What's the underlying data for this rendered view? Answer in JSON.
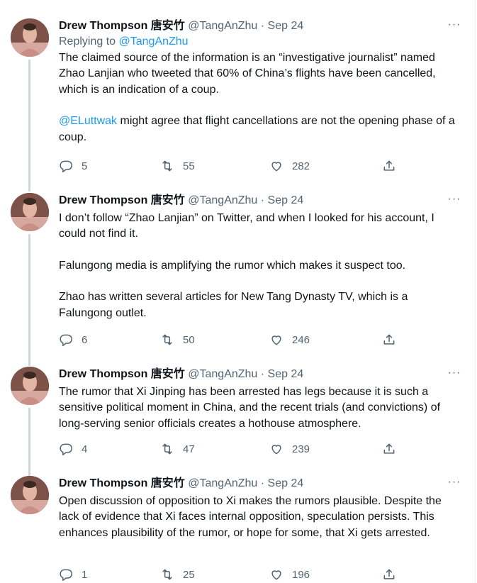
{
  "tweets": [
    {
      "name": "Drew Thompson 唐安竹",
      "handle": "@TangAnZhu",
      "date": "Sep 24",
      "replying_prefix": "Replying to ",
      "replying_to": "@TangAnZhu",
      "paragraphs": [
        "The claimed source of the information is an “investigative journalist” named Zhao Lanjian who tweeted that 60% of China’s flights have been cancelled, which is an indication of a coup."
      ],
      "mention_paragraph": {
        "mention": "@ELuttwak",
        "text": " might agree that flight cancellations are not the opening phase of a coup."
      },
      "replies": "5",
      "retweets": "55",
      "likes": "282"
    },
    {
      "name": "Drew Thompson 唐安竹",
      "handle": "@TangAnZhu",
      "date": "Sep 24",
      "paragraphs": [
        "I don’t follow “Zhao Lanjian” on Twitter, and when I looked for his account, I could not find it.",
        "Falungong media is amplifying the rumor which makes it suspect too.",
        "Zhao has written several articles for New Tang Dynasty TV, which is a Falungong outlet."
      ],
      "replies": "6",
      "retweets": "50",
      "likes": "246"
    },
    {
      "name": "Drew Thompson 唐安竹",
      "handle": "@TangAnZhu",
      "date": "Sep 24",
      "paragraphs": [
        "The rumor that Xi Jinping has been arrested has legs because it is such a sensitive political moment in China, and the recent trials (and convictions) of long-serving senior officials creates a hothouse atmosphere."
      ],
      "replies": "4",
      "retweets": "47",
      "likes": "239"
    },
    {
      "name": "Drew Thompson 唐安竹",
      "handle": "@TangAnZhu",
      "date": "Sep 24",
      "paragraphs": [
        "Open discussion of opposition to Xi makes the rumors plausible. Despite the lack of evidence that Xi faces internal opposition, speculation persists. This enhances plausibility of the rumor, or hope for some, that Xi gets arrested."
      ],
      "replies": "1",
      "retweets": "25",
      "likes": "196"
    }
  ],
  "dot_separator": " · ",
  "more_glyph": "···",
  "icons": [
    "reply-icon",
    "retweet-icon",
    "like-icon",
    "share-icon",
    "more-icon"
  ],
  "colors": {
    "link": "#1d9bf0",
    "secondary": "#536471",
    "thread_line": "#cfd9de"
  }
}
